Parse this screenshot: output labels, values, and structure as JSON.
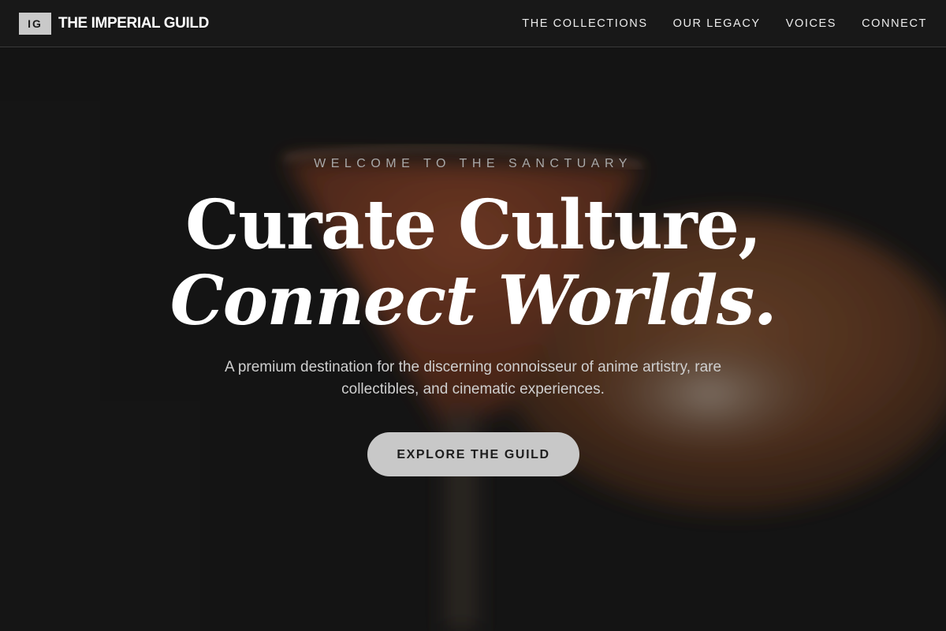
{
  "header": {
    "logo_mark": "IG",
    "brand_name": "THE IMPERIAL GUILD",
    "nav": [
      {
        "label": "THE COLLECTIONS"
      },
      {
        "label": "OUR LEGACY"
      },
      {
        "label": "VOICES"
      },
      {
        "label": "CONNECT"
      }
    ]
  },
  "hero": {
    "eyebrow": "WELCOME TO THE SANCTUARY",
    "headline_line1": "Curate Culture,",
    "headline_line2": "Connect Worlds.",
    "subtitle": "A premium destination for the discerning connoisseur of anime artistry, rare collectibles, and cinematic experiences.",
    "cta_label": "EXPLORE THE GUILD"
  },
  "colors": {
    "background": "#161616",
    "header_bg": "#181818",
    "accent_button": "#c8c8c8",
    "headline": "#ffffff"
  }
}
